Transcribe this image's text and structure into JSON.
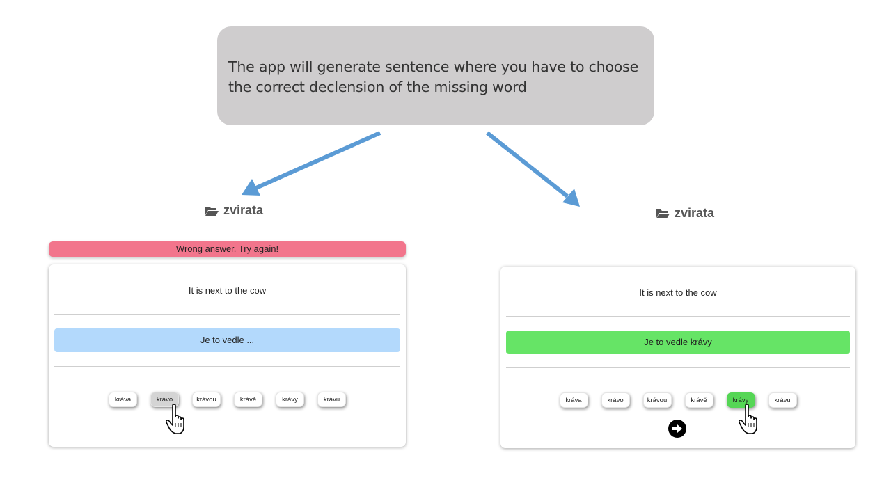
{
  "callout": {
    "text": "The app will generate sentence where you have to choose the correct declension of the missing word"
  },
  "left_panel": {
    "folder": {
      "icon": "folder-open-icon",
      "name": "zvirata"
    },
    "alert": {
      "text": "Wrong answer. Try again!",
      "color": "#f2758c"
    },
    "prompt": "It is next to the cow",
    "answer": "Je to vedle ...",
    "options": [
      "kráva",
      "krávo",
      "krávou",
      "krávě",
      "krávy",
      "krávu"
    ],
    "pressed_option": "krávo"
  },
  "right_panel": {
    "folder": {
      "icon": "folder-open-icon",
      "name": "zvirata"
    },
    "prompt": "It is next to the cow",
    "answer": "Je to vedle krávy",
    "options": [
      "kráva",
      "krávo",
      "krávou",
      "krávě",
      "krávy",
      "krávu"
    ],
    "selected_option": "krávy",
    "next_icon": "arrow-right-circle-icon",
    "correct_color": "#66e466"
  },
  "colors": {
    "blank_answer": "#b3d9fc",
    "callout_bg": "#cfcdce",
    "arrow": "#5b9bd5"
  }
}
